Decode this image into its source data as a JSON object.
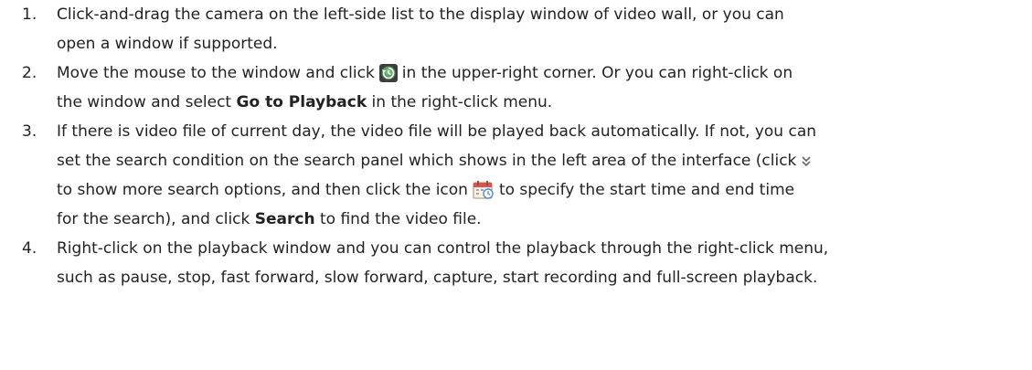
{
  "steps": [
    {
      "number": "1.",
      "lines": [
        "Click-and-drag the camera on the left-side list to the display window of video wall, or you can",
        "open a window if supported."
      ]
    },
    {
      "number": "2.",
      "line1_a": "Move the mouse to the window and click",
      "line1_b": "in the upper-right corner. Or you can right-click on",
      "line2_a": "the window and select",
      "line2_bold": "Go to Playback",
      "line2_b": "in the right-click menu.",
      "icon": "playback-icon"
    },
    {
      "number": "3.",
      "line1": "If there is video file of current day, the video file will be played back automatically. If not, you can",
      "line2_a": "set the search condition on the search panel which shows in the left area of the interface (click",
      "line3_a": "to show more search options, and then click the icon",
      "line3_b": "to specify the start time and end time",
      "line4_a": "for the search), and click",
      "line4_bold": "Search",
      "line4_b": "to find the video file.",
      "icon_expand": "double-chevron-down-icon",
      "icon_calendar": "calendar-icon"
    },
    {
      "number": "4.",
      "lines": [
        "Right-click on the playback window and you can control the playback through the right-click menu,",
        "such as pause, stop, fast forward, slow forward, capture, start recording and full-screen playback."
      ]
    }
  ]
}
